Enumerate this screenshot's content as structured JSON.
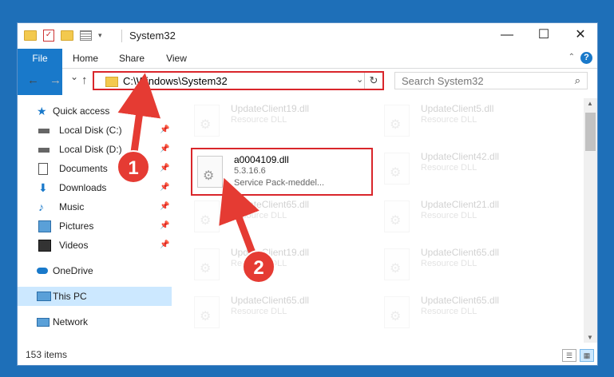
{
  "window": {
    "title": "System32",
    "minimize": "—",
    "maximize": "☐",
    "close": "✕"
  },
  "ribbon": {
    "tabs": [
      "File",
      "Home",
      "Share",
      "View"
    ],
    "help": "?"
  },
  "nav": {
    "back": "←",
    "forward": "→",
    "recent": "⌄",
    "up": "↑",
    "address": "C:\\Windows\\System32",
    "refresh": "↻",
    "search_placeholder": "Search System32",
    "search_icon": "⌕"
  },
  "sidebar": {
    "quick_access": "Quick access",
    "items": [
      {
        "label": "Local Disk (C:)",
        "icon": "drive-icon",
        "pinned": true
      },
      {
        "label": "Local Disk (D:)",
        "icon": "drive-icon",
        "pinned": true
      },
      {
        "label": "Documents",
        "icon": "documents-icon",
        "pinned": true
      },
      {
        "label": "Downloads",
        "icon": "downloads-icon",
        "pinned": true
      },
      {
        "label": "Music",
        "icon": "music-icon",
        "pinned": true
      },
      {
        "label": "Pictures",
        "icon": "pictures-icon",
        "pinned": true
      },
      {
        "label": "Videos",
        "icon": "videos-icon",
        "pinned": true
      }
    ],
    "onedrive": "OneDrive",
    "this_pc": "This PC",
    "network": "Network"
  },
  "files": {
    "left": [
      {
        "name": "UpdateClient19.dll",
        "type": "Resource DLL"
      },
      {
        "name": "a0004109.dll",
        "version": "5.3.16.6",
        "desc": "Service Pack-meddel..."
      },
      {
        "name": "UpdateClient65.dll",
        "type": "Resource DLL"
      },
      {
        "name": "UpdateClient19.dll",
        "type": "Resource DLL"
      },
      {
        "name": "UpdateClient65.dll",
        "type": "Resource DLL"
      }
    ],
    "right": [
      {
        "name": "UpdateClient5.dll",
        "type": "Resource DLL"
      },
      {
        "name": "UpdateClient42.dll",
        "type": "Resource DLL"
      },
      {
        "name": "UpdateClient21.dll",
        "type": "Resource DLL"
      },
      {
        "name": "UpdateClient65.dll",
        "type": "Resource DLL"
      },
      {
        "name": "UpdateClient65.dll",
        "type": "Resource DLL"
      }
    ]
  },
  "status": {
    "item_count": "153 items"
  },
  "annotations": {
    "step1": "1",
    "step2": "2"
  },
  "colors": {
    "accent": "#1979ca",
    "highlight": "#d9262b",
    "selected": "#cce8ff"
  }
}
